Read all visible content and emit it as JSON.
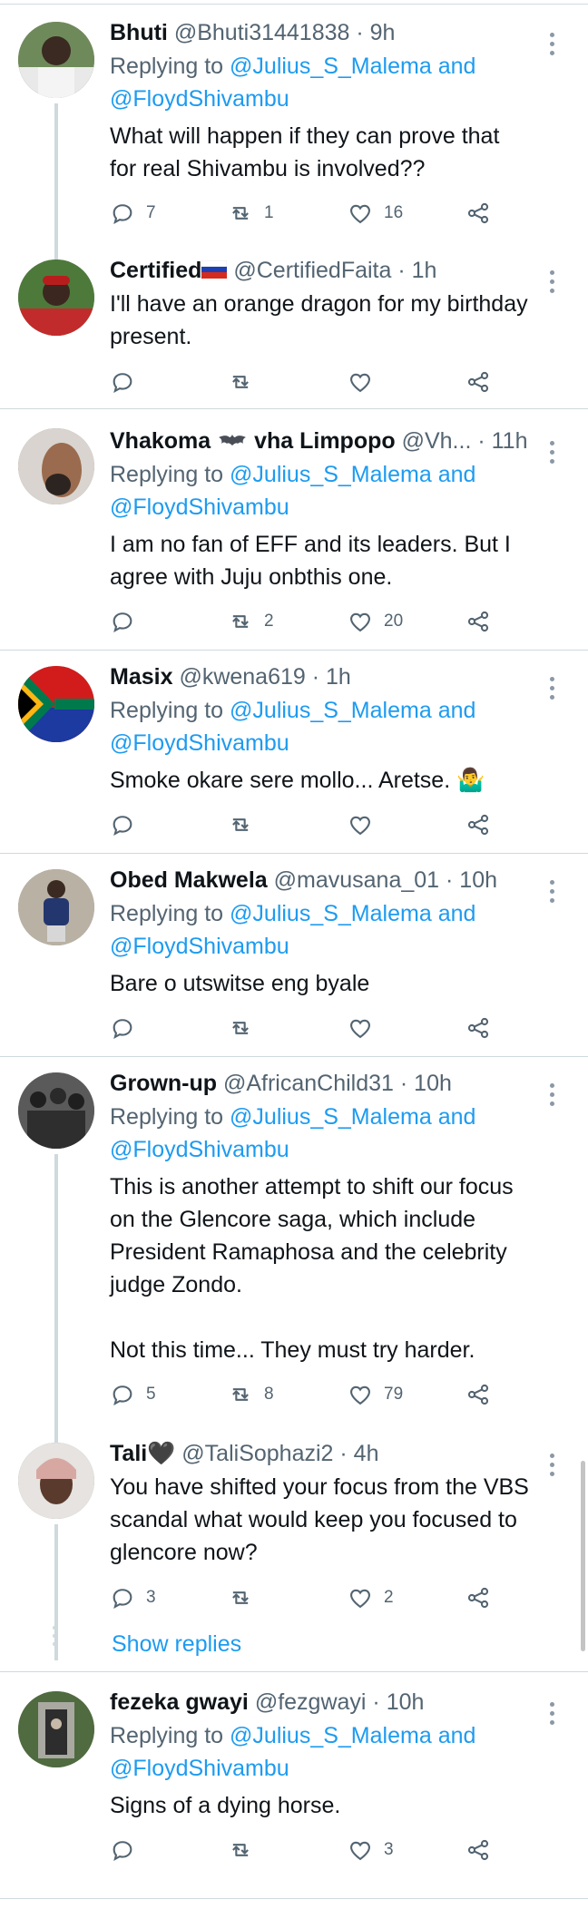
{
  "replying_label": "Replying to",
  "and_label": "and",
  "show_replies": "Show replies",
  "tweets": [
    {
      "name": "Bhuti",
      "handle": "@Bhuti31441838",
      "time": "· 9h",
      "reply_to_1": "@Julius_S_Malema",
      "reply_to_2": "@FloydShivambu",
      "lines": [
        "What will happen if they can prove that",
        "for real Shivambu is involved??"
      ],
      "replies": "7",
      "retweets": "1",
      "likes": "16"
    },
    {
      "name": "Certified",
      "handle": "@CertifiedFaita",
      "time": "· 1h",
      "lines": [
        "I'll have an orange dragon for my birthday",
        "present."
      ],
      "replies": "",
      "retweets": "",
      "likes": ""
    },
    {
      "name": "Vhakoma",
      "name_suffix": "vha Limpopo",
      "handle": "@Vh...",
      "time": "· 11h",
      "reply_to_1": "@Julius_S_Malema",
      "reply_to_2": "@FloydShivambu",
      "lines": [
        "I am no fan of EFF and its leaders. But I",
        "agree with Juju onbthis one."
      ],
      "replies": "",
      "retweets": "2",
      "likes": "20"
    },
    {
      "name": "Masix",
      "handle": "@kwena619",
      "time": "· 1h",
      "reply_to_1": "@Julius_S_Malema",
      "reply_to_2": "@FloydShivambu",
      "lines": [
        "Smoke okare sere mollo... Aretse. 🤷‍♂️"
      ],
      "replies": "",
      "retweets": "",
      "likes": ""
    },
    {
      "name": "Obed Makwela",
      "handle": "@mavusana_01",
      "time": "· 10h",
      "reply_to_1": "@Julius_S_Malema",
      "reply_to_2": "@FloydShivambu",
      "lines": [
        "Bare o utswitse eng byale"
      ],
      "replies": "",
      "retweets": "",
      "likes": ""
    },
    {
      "name": "Grown-up",
      "handle": "@AfricanChild31",
      "time": "· 10h",
      "reply_to_1": "@Julius_S_Malema",
      "reply_to_2": "@FloydShivambu",
      "lines": [
        "This is another attempt to shift our focus",
        "on the Glencore saga, which include",
        "President Ramaphosa and the celebrity",
        "judge Zondo.",
        "",
        "Not this time... They must try harder."
      ],
      "replies": "5",
      "retweets": "8",
      "likes": "79"
    },
    {
      "name": "Tali🖤",
      "handle": "@TaliSophazi2",
      "time": "· 4h",
      "lines": [
        "You have shifted your focus from the VBS",
        "scandal what would keep you focused to",
        "glencore now?"
      ],
      "replies": "3",
      "retweets": "",
      "likes": "2"
    },
    {
      "name": "fezeka gwayi",
      "handle": "@fezgwayi",
      "time": "· 10h",
      "reply_to_1": "@Julius_S_Malema",
      "reply_to_2": "@FloydShivambu",
      "lines": [
        "Signs of a dying horse."
      ],
      "replies": "",
      "retweets": "",
      "likes": "3"
    }
  ],
  "icons": {
    "reply": "reply-icon",
    "retweet": "retweet-icon",
    "like": "heart-icon",
    "share": "share-icon",
    "more": "more-icon",
    "bat": "bat-icon",
    "flag": "russia-flag-icon"
  },
  "colors": {
    "link": "#1d9bf0",
    "muted": "#536471",
    "separator": "#cfd9de"
  }
}
